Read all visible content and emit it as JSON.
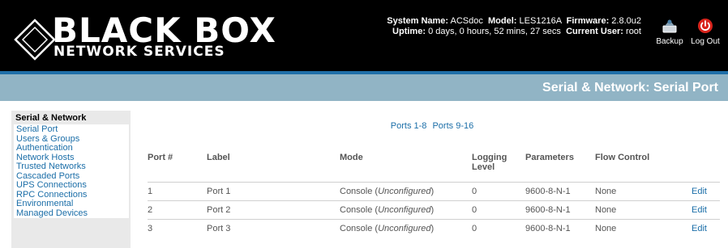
{
  "header": {
    "brand_main": "BLACK BOX",
    "brand_sub": "NETWORK SERVICES",
    "system_name_label": "System Name:",
    "system_name": "ACSdoc",
    "model_label": "Model:",
    "model": "LES1216A",
    "firmware_label": "Firmware:",
    "firmware": "2.8.0u2",
    "uptime_label": "Uptime:",
    "uptime": "0 days, 0 hours, 52 mins, 27 secs",
    "current_user_label": "Current User:",
    "current_user": "root",
    "backup_label": "Backup",
    "logout_label": "Log Out"
  },
  "page_title": "Serial & Network: Serial Port",
  "sidebar": {
    "heading": "Serial & Network",
    "items": [
      {
        "label": "Serial Port"
      },
      {
        "label": "Users & Groups"
      },
      {
        "label": "Authentication"
      },
      {
        "label": "Network Hosts"
      },
      {
        "label": "Trusted Networks"
      },
      {
        "label": "Cascaded Ports"
      },
      {
        "label": "UPS Connections"
      },
      {
        "label": "RPC Connections"
      },
      {
        "label": "Environmental"
      },
      {
        "label": "Managed Devices"
      }
    ]
  },
  "pager": {
    "ports_1_8": "Ports 1-8",
    "ports_9_16": "Ports 9-16"
  },
  "table": {
    "columns": {
      "port": "Port #",
      "label": "Label",
      "mode": "Mode",
      "logging": "Logging Level",
      "parameters": "Parameters",
      "flow": "Flow Control"
    },
    "rows": [
      {
        "port": "1",
        "label": "Port 1",
        "mode_prefix": "Console (",
        "mode_state": "Unconfigured",
        "mode_suffix": ")",
        "logging": "0",
        "parameters": "9600-8-N-1",
        "flow": "None",
        "action": "Edit"
      },
      {
        "port": "2",
        "label": "Port 2",
        "mode_prefix": "Console (",
        "mode_state": "Unconfigured",
        "mode_suffix": ")",
        "logging": "0",
        "parameters": "9600-8-N-1",
        "flow": "None",
        "action": "Edit"
      },
      {
        "port": "3",
        "label": "Port 3",
        "mode_prefix": "Console (",
        "mode_state": "Unconfigured",
        "mode_suffix": ")",
        "logging": "0",
        "parameters": "9600-8-N-1",
        "flow": "None",
        "action": "Edit"
      }
    ]
  },
  "colors": {
    "header_bg": "#000000",
    "title_bar": "#91b4c5",
    "accent_strip": "#1f6fa8",
    "link": "#1b6ea8",
    "logout_red": "#d9241c"
  },
  "icons": {
    "backup": "backup-icon",
    "logout": "power-icon",
    "logo": "diamond-logo-icon"
  }
}
